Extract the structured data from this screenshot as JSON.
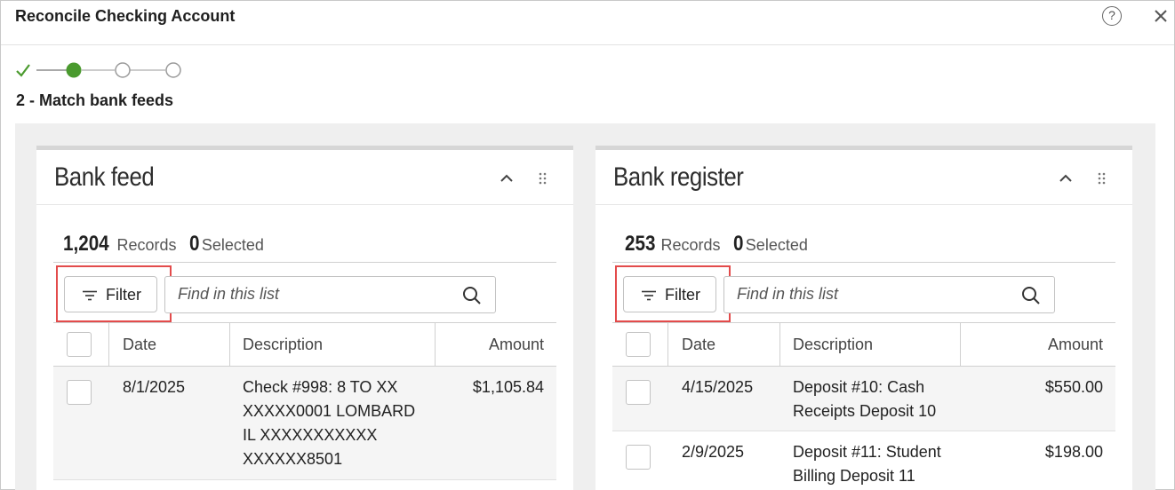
{
  "dialog": {
    "title": "Reconcile Checking Account",
    "help_label": "?",
    "close_icon": "close-icon"
  },
  "stepper": {
    "current_step_label": "2 - Match bank feeds",
    "steps": [
      "completed",
      "current",
      "pending",
      "pending"
    ],
    "colors": {
      "completed": "#4a9a2e",
      "pending": "#9a9a9a"
    }
  },
  "bank_feed": {
    "title": "Bank feed",
    "records_count": "1,204",
    "records_label": "Records",
    "selected_count": "0",
    "selected_label": "Selected",
    "filter_label": "Filter",
    "search_placeholder": "Find in this list",
    "columns": {
      "date": "Date",
      "description": "Description",
      "amount": "Amount"
    },
    "rows": [
      {
        "date": "8/1/2025",
        "description": "Check #998: 8 TO XX XXXXX0001 LOMBARD IL XXXXXXXXXXX XXXXXX8501",
        "amount": "$1,105.84"
      }
    ]
  },
  "bank_register": {
    "title": "Bank register",
    "records_count": "253",
    "records_label": "Records",
    "selected_count": "0",
    "selected_label": "Selected",
    "filter_label": "Filter",
    "search_placeholder": "Find in this list",
    "columns": {
      "date": "Date",
      "description": "Description",
      "amount": "Amount"
    },
    "rows": [
      {
        "date": "4/15/2025",
        "description": "Deposit #10: Cash Receipts Deposit 10",
        "amount": "$550.00"
      },
      {
        "date": "2/9/2025",
        "description": "Deposit #11: Student Billing Deposit 11",
        "amount": "$198.00"
      }
    ]
  },
  "highlight_color": "#e34b4b"
}
